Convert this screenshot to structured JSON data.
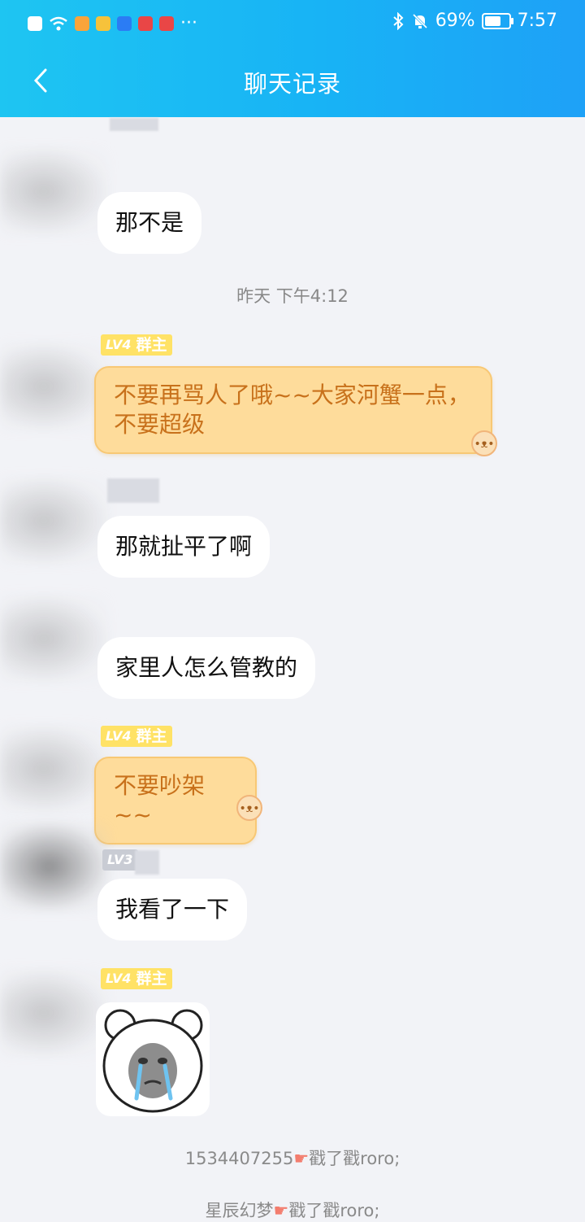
{
  "status_bar": {
    "battery": "69%",
    "time": "7:57",
    "notif_dots": "···"
  },
  "navbar": {
    "title": "聊天记录"
  },
  "messages": [
    {
      "text": "那不是"
    },
    {
      "timestamp": "昨天 下午4:12"
    },
    {
      "badge_level": "LV4",
      "badge_role": "群主",
      "text": "不要再骂人了哦~~大家河蟹一点，不要超级"
    },
    {
      "text": "那就扯平了啊"
    },
    {
      "text": "家里人怎么管教的"
    },
    {
      "badge_level": "LV4",
      "badge_role": "群主",
      "text": "不要吵架~~"
    },
    {
      "badge_level": "LV3",
      "text": "我看了一下"
    },
    {
      "badge_level": "LV4",
      "badge_role": "群主",
      "sticker": "crying-bear-sticker"
    }
  ],
  "system": [
    {
      "actor": "1534407255",
      "action": "戳了戳roro;"
    },
    {
      "actor": "星辰幻梦",
      "action": "戳了戳roro;"
    }
  ],
  "colors": {
    "header_start": "#1ec5f2",
    "header_end": "#1ea1f7",
    "owner_bubble": "#fedc9b",
    "owner_text": "#c8711b",
    "badge": "#ffe266"
  }
}
